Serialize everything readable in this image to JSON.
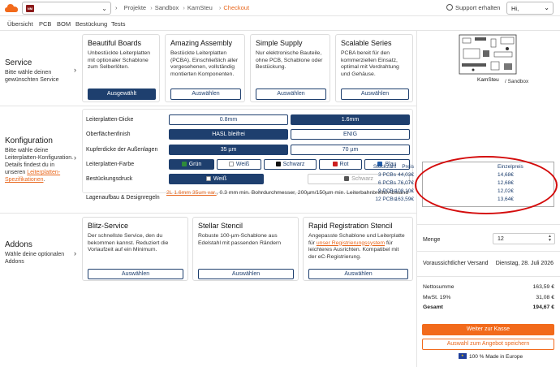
{
  "header": {
    "project_thumb_text": "NM",
    "breadcrumbs": [
      "Projekte",
      "Sandbox",
      "KamSteu",
      "Checkout"
    ],
    "support": "Support erhalten",
    "user_greeting": "Hi,"
  },
  "subnav": [
    "Übersicht",
    "PCB",
    "BOM",
    "Bestückung",
    "Tests"
  ],
  "service": {
    "title": "Service",
    "desc": "Bitte wähle deinen gewünschten Service",
    "cards": [
      {
        "title": "Beautiful Boards",
        "desc": "Unbestückte Leiterplatten mit optionaler Schablone zum Selberlöten.",
        "button": "Ausgewählt",
        "selected": true
      },
      {
        "title": "Amazing Assembly",
        "desc": "Bestückte Leiterplatten (PCBA). Einschließlich aller vorgesehenen, vollständig montierten Komponenten.",
        "button": "Auswählen",
        "selected": false
      },
      {
        "title": "Simple Supply",
        "desc": "Nur elektronische Bauteile, ohne PCB, Schablone oder Bestückung.",
        "button": "Auswählen",
        "selected": false
      },
      {
        "title": "Scalable Series",
        "desc": "PCBA bereit für den kommerziellen Einsatz, optimal mit Verdrahtung und Gehäuse.",
        "button": "Auswählen",
        "selected": false
      }
    ]
  },
  "config": {
    "title": "Konfiguration",
    "desc_pre": "Bitte wähle deine Leiterplatten-Konfiguration. Details findest du in unseren",
    "desc_link": "Leiterplatten-Spezifikationen",
    "desc_post": ".",
    "labels": {
      "thickness": "Leiterplatten-Dicke",
      "finish": "Oberflächenfinish",
      "copper": "Kupferdicke der Außenlagen",
      "color": "Leiterplatten-Farbe",
      "print": "Bestückungsdruck",
      "layers": "Lagenaufbau & Designregeln"
    },
    "thickness_options": [
      "0.8mm",
      "1.6mm"
    ],
    "finish_options": [
      "HASL bleifrei",
      "ENIG"
    ],
    "copper_options": [
      "35 µm",
      "70 µm"
    ],
    "color_options": [
      {
        "label": "Grün",
        "swatch": "#2e8b3a"
      },
      {
        "label": "Weiß",
        "swatch": "#ffffff"
      },
      {
        "label": "Schwarz",
        "swatch": "#111111"
      },
      {
        "label": "Rot",
        "swatch": "#cc1f1f"
      },
      {
        "label": "Blau",
        "swatch": "#1e5aa8"
      }
    ],
    "print_options": [
      {
        "label": "Weiß",
        "swatch": "#ffffff"
      },
      {
        "label": "Schwarz",
        "swatch": "#555555"
      }
    ],
    "layers_link": "2L 1.6mm 35um var.",
    "layers_text": ", 0.3 mm min. Bohrdurchmesser, 200µm/150µm min. Leiterbahnbreite/Abstand"
  },
  "addons": {
    "title": "Addons",
    "desc": "Wähle deine optionalen Addons",
    "cards": [
      {
        "title": "Blitz-Service",
        "desc": "Der schnellste Service, den du bekommen kannst. Reduziert die Vorlaufzeit auf ein Minimum.",
        "button": "Auswählen"
      },
      {
        "title": "Stellar Stencil",
        "desc": "Robuste 100-µm-Schablone aus Edelstahl mit passenden Rändern",
        "button": "Auswählen"
      },
      {
        "title": "Rapid Registration Stencil",
        "desc_pre": "Angepasste Schablone und Leiterplatte für ",
        "desc_link": "unser Registrierungssystem",
        "desc_post": " für leichteres Ausrichten. Kompatibel mit der eC-Registrierung.",
        "button": "Auswählen"
      }
    ]
  },
  "summary": {
    "pcb_name": "KamSteu",
    "pcb_folder": "/ Sandbox",
    "price_headers": [
      "Stückzahl",
      "Preis",
      "Einzelpreis"
    ],
    "price_rows": [
      [
        "3 PCBs",
        "44,03€",
        "14,68€"
      ],
      [
        "6 PCBs",
        "76,07€",
        "12,68€"
      ],
      [
        "9 PCBs",
        "108,10€",
        "12,02€"
      ],
      [
        "12 PCBs",
        "163,59€",
        "13,64€"
      ]
    ],
    "quantity_label": "Menge",
    "quantity_value": "12",
    "shipping_label": "Voraussichtlicher Versand",
    "shipping_value": "Dienstag, 28. Juli 2026",
    "net_label": "Nettosumme",
    "net_value": "163,59 €",
    "vat_label": "MwSt. 19%",
    "vat_value": "31,08 €",
    "total_label": "Gesamt",
    "total_value": "194,67 €",
    "checkout_button": "Weiter zur Kasse",
    "quote_button": "Auswahl zum Angebot speichern",
    "made_in": "100 % Made in Europe"
  },
  "colors": {
    "primary": "#1e3f6e",
    "accent": "#f26a1b",
    "highlight": "#d40c0c"
  }
}
